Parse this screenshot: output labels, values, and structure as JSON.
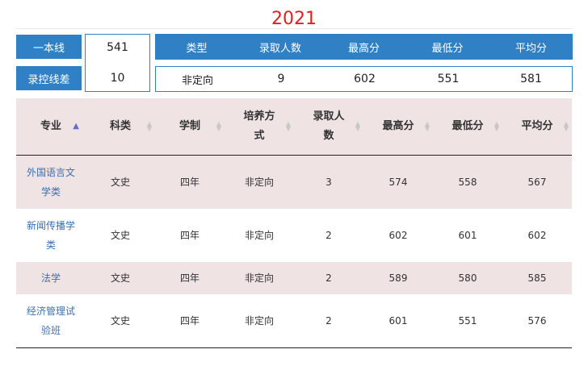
{
  "year": "2021",
  "summary": {
    "line1_label": "一本线",
    "line1_value": "541",
    "line2_label": "录控线差",
    "line2_value": "10",
    "headers": [
      "类型",
      "录取人数",
      "最高分",
      "最低分",
      "平均分"
    ],
    "values": [
      "非定向",
      "9",
      "602",
      "551",
      "581"
    ]
  },
  "table": {
    "headers": [
      "专业",
      "科类",
      "学制",
      "培养方式",
      "录取人数",
      "最高分",
      "最低分",
      "平均分"
    ],
    "rows": [
      [
        "外国语言文学类",
        "文史",
        "四年",
        "非定向",
        "3",
        "574",
        "558",
        "567"
      ],
      [
        "新闻传播学类",
        "文史",
        "四年",
        "非定向",
        "2",
        "602",
        "601",
        "602"
      ],
      [
        "法学",
        "文史",
        "四年",
        "非定向",
        "2",
        "589",
        "580",
        "585"
      ],
      [
        "经济管理试验班",
        "文史",
        "四年",
        "非定向",
        "2",
        "601",
        "551",
        "576"
      ]
    ]
  },
  "colors": {
    "accent": "#2f80c4",
    "year": "#e02020",
    "header_bg": "#efe3e3",
    "link": "#3b6fb0"
  }
}
